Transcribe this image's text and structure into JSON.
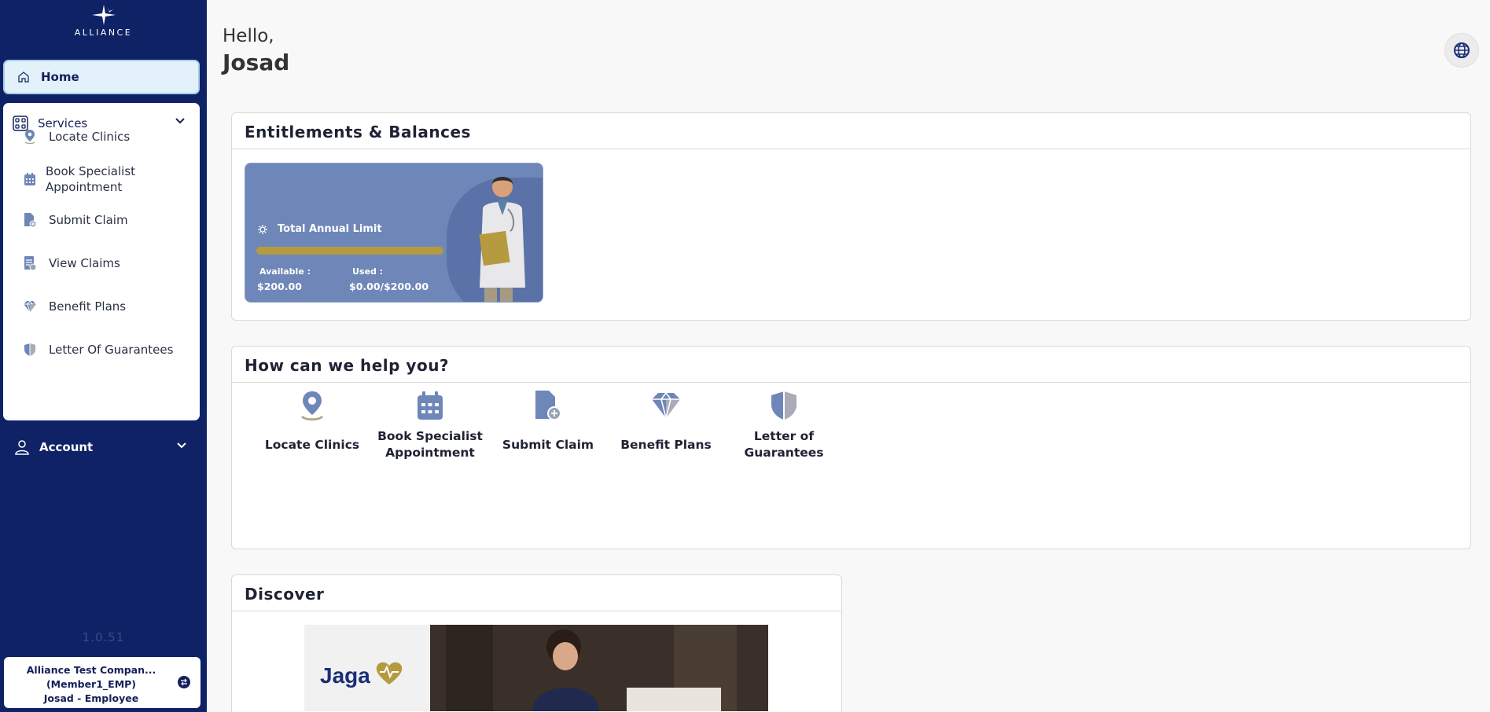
{
  "brand": {
    "name": "ALLIANCE"
  },
  "sidebar": {
    "home_label": "Home",
    "services_label": "Services",
    "services_items": [
      {
        "label": "Locate Clinics",
        "icon": "location-pin-icon"
      },
      {
        "label": "Book Specialist Appointment",
        "icon": "calendar-icon"
      },
      {
        "label": "Submit Claim",
        "icon": "document-add-icon"
      },
      {
        "label": "View Claims",
        "icon": "document-list-icon"
      },
      {
        "label": "Benefit Plans",
        "icon": "diamond-icon"
      },
      {
        "label": "Letter Of Guarantees",
        "icon": "shield-icon"
      }
    ],
    "account_label": "Account",
    "version": "1.0.51",
    "company": {
      "line1": "Alliance Test Compan...",
      "line2": "(Member1_EMP)",
      "line3": "Josad - Employee"
    }
  },
  "greeting": {
    "hello": "Hello,",
    "name": "Josad"
  },
  "entitlements": {
    "title": "Entitlements & Balances",
    "card": {
      "title": "Total Annual Limit",
      "available_label": "Available :",
      "available_value": "$200.00",
      "used_label": "Used :",
      "used_value": "$0.00/$200.00",
      "used_fraction": 0
    }
  },
  "help": {
    "title": "How can we help you?",
    "tiles": [
      {
        "label": "Locate Clinics",
        "icon": "location-pin-icon"
      },
      {
        "label": "Book Specialist Appointment",
        "icon": "calendar-icon"
      },
      {
        "label": "Submit Claim",
        "icon": "document-add-icon"
      },
      {
        "label": "Benefit Plans",
        "icon": "diamond-icon"
      },
      {
        "label": "Letter of Guarantees",
        "icon": "shield-icon"
      }
    ]
  },
  "discover": {
    "title": "Discover"
  },
  "colors": {
    "sidebar": "#0f2266",
    "accent_blue": "#6f87b8",
    "accent_gold": "#b59a3f"
  }
}
